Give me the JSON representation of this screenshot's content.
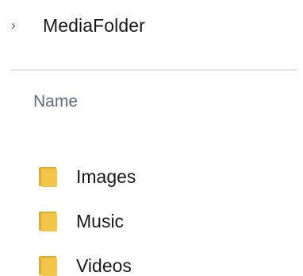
{
  "breadcrumb": {
    "separator_icon": "chevron-right-icon",
    "current_folder": "MediaFolder"
  },
  "column_header": {
    "label": "Name"
  },
  "items": [
    {
      "label": "Images",
      "icon": "folder-icon"
    },
    {
      "label": "Music",
      "icon": "folder-icon"
    },
    {
      "label": "Videos",
      "icon": "folder-icon"
    }
  ],
  "colors": {
    "folder": "#f3c64a",
    "folder_shade": "#e1ac2b",
    "header_text": "#5f6b7a",
    "divider": "#e3e3e3"
  }
}
